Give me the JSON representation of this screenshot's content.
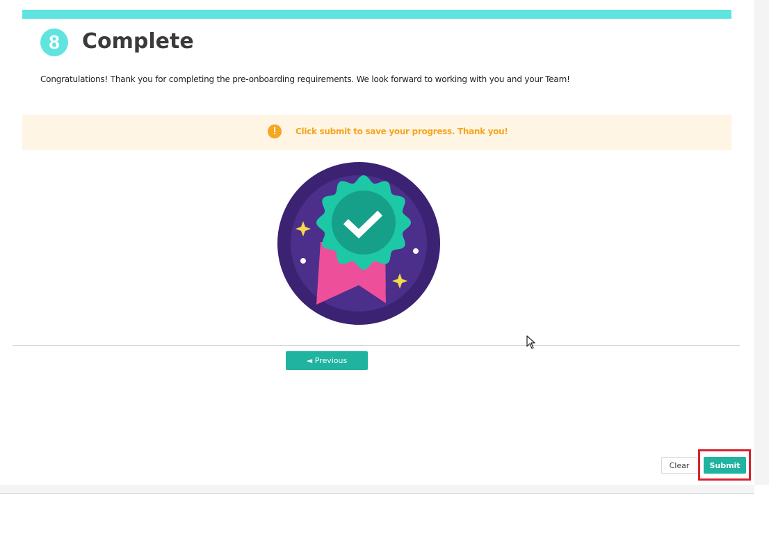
{
  "colors": {
    "accent_teal": "#1fb3a0",
    "top_bar": "#5fe4e0",
    "step_circle": "#5fe4e0",
    "notice_background": "#fef5e4",
    "notice_text": "#f5a623",
    "notice_icon": "#f5a623",
    "highlight_border": "#d9202a",
    "badge_outer": "#3c2273",
    "badge_inner": "#4b2f8a",
    "rosette": "#1dc8a6",
    "rosette_center": "#17a089",
    "ribbon": "#ee4f9b",
    "sparkle": "#f6d94a"
  },
  "step": {
    "number": "8",
    "title": "Complete"
  },
  "intro": {
    "text": "Congratulations! Thank you for completing the pre-onboarding requirements. We look forward to working with you and your Team!"
  },
  "notice": {
    "icon": "exclamation-circle-icon",
    "text": "Click submit to save your progress. Thank you!"
  },
  "badge": {
    "icon": "completion-badge-icon"
  },
  "navigation": {
    "previous_label": "◄ Previous"
  },
  "actions": {
    "clear_label": "Clear",
    "submit_label": "Submit"
  }
}
